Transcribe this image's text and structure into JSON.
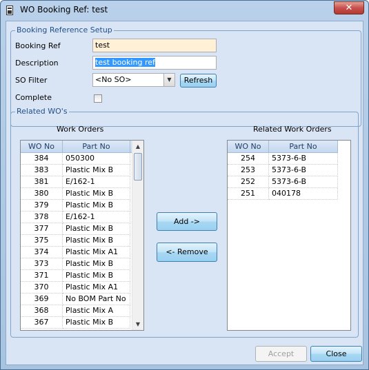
{
  "window": {
    "title": "WO Booking Ref: test",
    "close_glyph": "✕"
  },
  "setup": {
    "group_title": "Booking Reference Setup",
    "booking_ref_label": "Booking Ref",
    "booking_ref_value": "test",
    "description_label": "Description",
    "description_value": "test booking ref",
    "so_filter_label": "SO Filter",
    "so_filter_value": "<No SO>",
    "refresh_label": "Refresh",
    "complete_label": "Complete",
    "complete_checked": false
  },
  "related": {
    "group_title": "Related WO's",
    "work_orders_title": "Work Orders",
    "related_title": "Related Work Orders",
    "col_wo": "WO No",
    "col_part": "Part No",
    "work_orders": [
      {
        "wo": "384",
        "part": "050300"
      },
      {
        "wo": "383",
        "part": "Plastic Mix B"
      },
      {
        "wo": "381",
        "part": "E/162-1"
      },
      {
        "wo": "380",
        "part": "Plastic Mix B"
      },
      {
        "wo": "379",
        "part": "Plastic Mix B"
      },
      {
        "wo": "378",
        "part": "E/162-1"
      },
      {
        "wo": "377",
        "part": "Plastic Mix B"
      },
      {
        "wo": "375",
        "part": "Plastic Mix B"
      },
      {
        "wo": "374",
        "part": "Plastic Mix A1"
      },
      {
        "wo": "373",
        "part": "Plastic Mix B"
      },
      {
        "wo": "371",
        "part": "Plastic Mix B"
      },
      {
        "wo": "370",
        "part": "Plastic Mix A1"
      },
      {
        "wo": "369",
        "part": "No BOM Part No"
      },
      {
        "wo": "368",
        "part": "Plastic Mix A"
      },
      {
        "wo": "367",
        "part": "Plastic Mix B"
      }
    ],
    "related_orders": [
      {
        "wo": "254",
        "part": "5373-6-B"
      },
      {
        "wo": "253",
        "part": "5373-6-B"
      },
      {
        "wo": "252",
        "part": "5373-6-B"
      },
      {
        "wo": "251",
        "part": "040178"
      }
    ],
    "add_label": "Add ->",
    "remove_label": "<- Remove"
  },
  "footer": {
    "accept_label": "Accept",
    "close_label": "Close"
  }
}
